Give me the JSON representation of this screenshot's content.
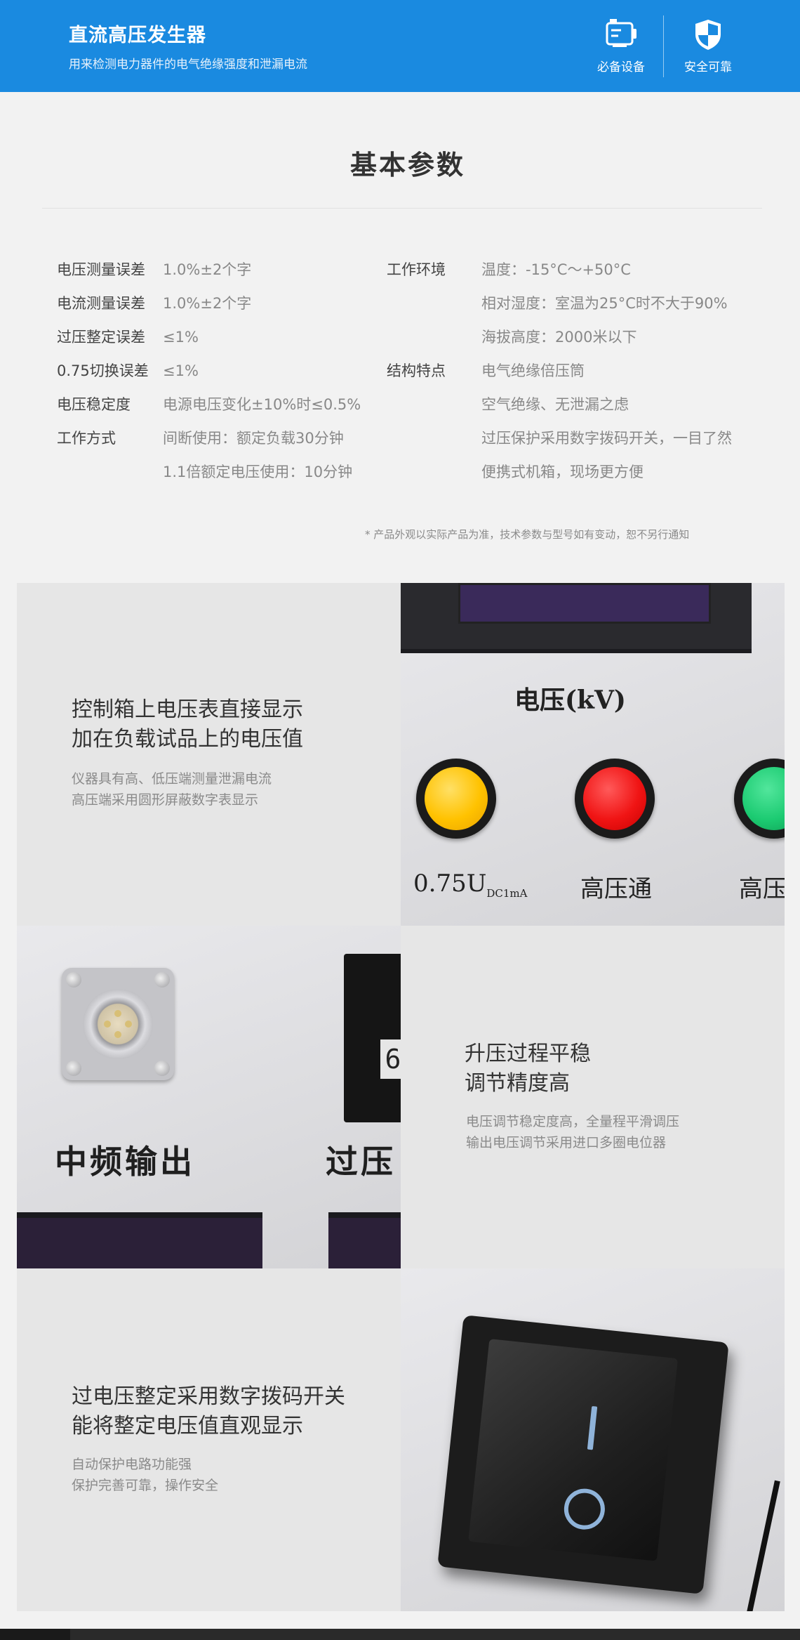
{
  "header": {
    "title": "直流高压发生器",
    "subtitle": "用来检测电力器件的电气绝缘强度和泄漏电流",
    "features": [
      {
        "label": "必备设备",
        "icon": "device-icon"
      },
      {
        "label": "安全可靠",
        "icon": "shield-icon"
      }
    ],
    "background": "#1a8ae0"
  },
  "params_section": {
    "title": "基本参数",
    "left": [
      {
        "label": "电压测量误差",
        "value": "1.0%±2个字"
      },
      {
        "label": "电流测量误差",
        "value": "1.0%±2个字"
      },
      {
        "label": "过压整定误差",
        "value": "≤1%"
      },
      {
        "label": "0.75切换误差",
        "value": "≤1%"
      },
      {
        "label": "电压稳定度",
        "value": "电源电压变化±10%时≤0.5%"
      },
      {
        "label": "工作方式",
        "value": "间断使用：额定负载30分钟"
      },
      {
        "label": "",
        "value": "1.1倍额定电压使用：10分钟"
      }
    ],
    "right": [
      {
        "label": "工作环境",
        "value": "温度：-15°C～+50°C"
      },
      {
        "label": "",
        "value": "相对湿度：室温为25°C时不大于90%"
      },
      {
        "label": "",
        "value": "海拔高度：2000米以下"
      },
      {
        "label": "结构特点",
        "value": "电气绝缘倍压筒"
      },
      {
        "label": "",
        "value": "空气绝缘、无泄漏之虑"
      },
      {
        "label": "",
        "value": "过压保护采用数字拨码开关，一目了然"
      },
      {
        "label": "",
        "value": "便携式机箱，现场更方便"
      }
    ],
    "disclaimer": "* 产品外观以实际产品为准，技术参数与型号如有变动，恕不另行通知"
  },
  "features_grid": [
    {
      "heading": [
        "控制箱上电压表直接显示",
        "加在负载试品上的电压值"
      ],
      "desc": [
        "仪器具有高、低压端测量泄漏电流",
        "高压端采用圆形屏蔽数字表显示"
      ]
    },
    {
      "heading": [
        "升压过程平稳",
        "调节精度高"
      ],
      "desc": [
        "电压调节稳定度高，全量程平滑调压",
        "输出电压调节采用进口多圈电位器"
      ]
    },
    {
      "heading": [
        "过电压整定采用数字拨码开关",
        "能将整定电压值直观显示"
      ],
      "desc": [
        "自动保护电路功能强",
        "保护完善可靠，操作安全"
      ]
    }
  ],
  "photos": {
    "panel": {
      "kv_label": "电压(kV)",
      "lamp1_label": "0.75U",
      "lamp1_sub": "DC1mA",
      "lamp2_label": "高压通",
      "lamp3_label": "高压"
    },
    "connector": {
      "label1": "中频输出",
      "label2": "过压",
      "counter_digit": "6"
    },
    "lamp_colors": {
      "yellow": "#ffc200",
      "red": "#f01414",
      "green": "#1ccb72"
    }
  }
}
